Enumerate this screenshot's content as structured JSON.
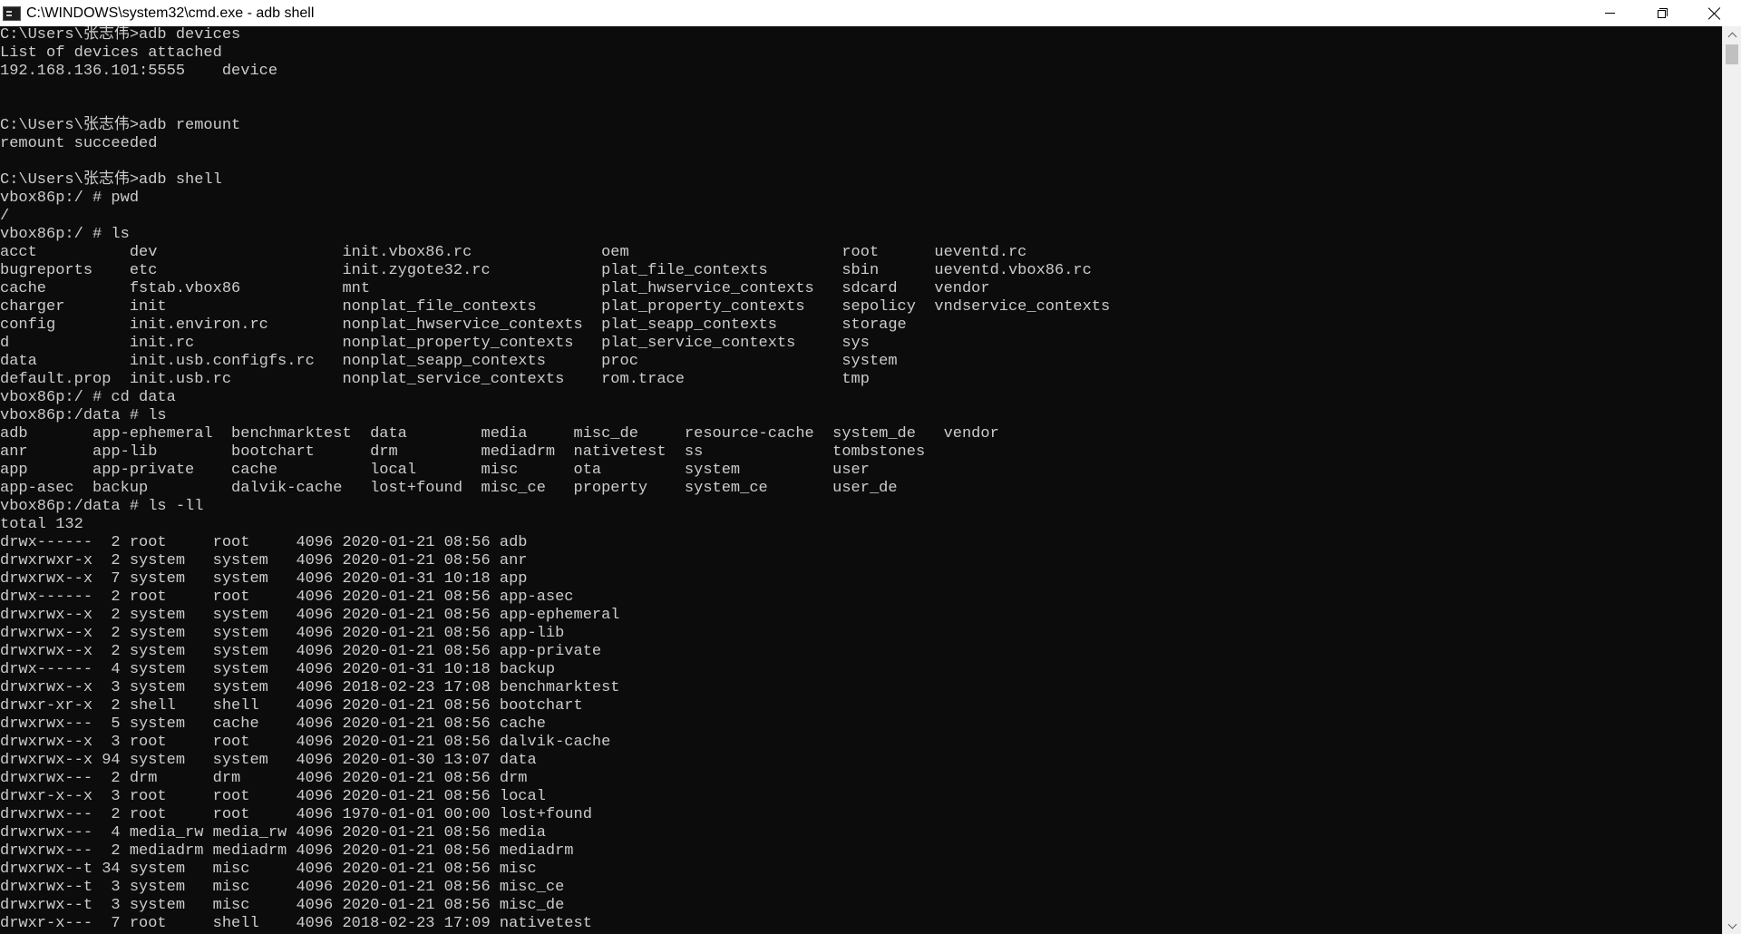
{
  "window": {
    "title": "C:\\WINDOWS\\system32\\cmd.exe - adb  shell",
    "icon": "cmd-icon",
    "controls": {
      "minimize": "minimize-icon",
      "restore": "restore-icon",
      "close": "close-icon"
    }
  },
  "console": {
    "lines": [
      "C:\\Users\\张志伟>adb devices",
      "List of devices attached",
      "192.168.136.101:5555    device",
      "",
      "",
      "C:\\Users\\张志伟>adb remount",
      "remount succeeded",
      "",
      "C:\\Users\\张志伟>adb shell",
      "vbox86p:/ # pwd",
      "/",
      "vbox86p:/ # ls",
      "acct          dev                    init.vbox86.rc              oem                       root      ueventd.rc",
      "bugreports    etc                    init.zygote32.rc            plat_file_contexts        sbin      ueventd.vbox86.rc",
      "cache         fstab.vbox86           mnt                         plat_hwservice_contexts   sdcard    vendor",
      "charger       init                   nonplat_file_contexts       plat_property_contexts    sepolicy  vndservice_contexts",
      "config        init.environ.rc        nonplat_hwservice_contexts  plat_seapp_contexts       storage",
      "d             init.rc                nonplat_property_contexts   plat_service_contexts     sys",
      "data          init.usb.configfs.rc   nonplat_seapp_contexts      proc                      system",
      "default.prop  init.usb.rc            nonplat_service_contexts    rom.trace                 tmp",
      "vbox86p:/ # cd data",
      "vbox86p:/data # ls",
      "adb       app-ephemeral  benchmarktest  data        media     misc_de     resource-cache  system_de   vendor",
      "anr       app-lib        bootchart      drm         mediadrm  nativetest  ss              tombstones",
      "app       app-private    cache          local       misc      ota         system          user",
      "app-asec  backup         dalvik-cache   lost+found  misc_ce   property    system_ce       user_de",
      "vbox86p:/data # ls -ll",
      "total 132",
      "drwx------  2 root     root     4096 2020-01-21 08:56 adb",
      "drwxrwxr-x  2 system   system   4096 2020-01-21 08:56 anr",
      "drwxrwx--x  7 system   system   4096 2020-01-31 10:18 app",
      "drwx------  2 root     root     4096 2020-01-21 08:56 app-asec",
      "drwxrwx--x  2 system   system   4096 2020-01-21 08:56 app-ephemeral",
      "drwxrwx--x  2 system   system   4096 2020-01-21 08:56 app-lib",
      "drwxrwx--x  2 system   system   4096 2020-01-21 08:56 app-private",
      "drwx------  4 system   system   4096 2020-01-31 10:18 backup",
      "drwxrwx--x  3 system   system   4096 2018-02-23 17:08 benchmarktest",
      "drwxr-xr-x  2 shell    shell    4096 2020-01-21 08:56 bootchart",
      "drwxrwx---  5 system   cache    4096 2020-01-21 08:56 cache",
      "drwxrwx--x  3 root     root     4096 2020-01-21 08:56 dalvik-cache",
      "drwxrwx--x 94 system   system   4096 2020-01-30 13:07 data",
      "drwxrwx---  2 drm      drm      4096 2020-01-21 08:56 drm",
      "drwxr-x--x  3 root     root     4096 2020-01-21 08:56 local",
      "drwxrwx---  2 root     root     4096 1970-01-01 00:00 lost+found",
      "drwxrwx---  4 media_rw media_rw 4096 2020-01-21 08:56 media",
      "drwxrwx---  2 mediadrm mediadrm 4096 2020-01-21 08:56 mediadrm",
      "drwxrwx--t 34 system   misc     4096 2020-01-21 08:56 misc",
      "drwxrwx--t  3 system   misc     4096 2020-01-21 08:56 misc_ce",
      "drwxrwx--t  3 system   misc     4096 2020-01-21 08:56 misc_de",
      "drwxr-x---  7 root     shell    4096 2018-02-23 17:09 nativetest"
    ]
  },
  "colors": {
    "background": "#0c0c0c",
    "foreground": "#cccccc",
    "titlebar": "#ffffff"
  }
}
